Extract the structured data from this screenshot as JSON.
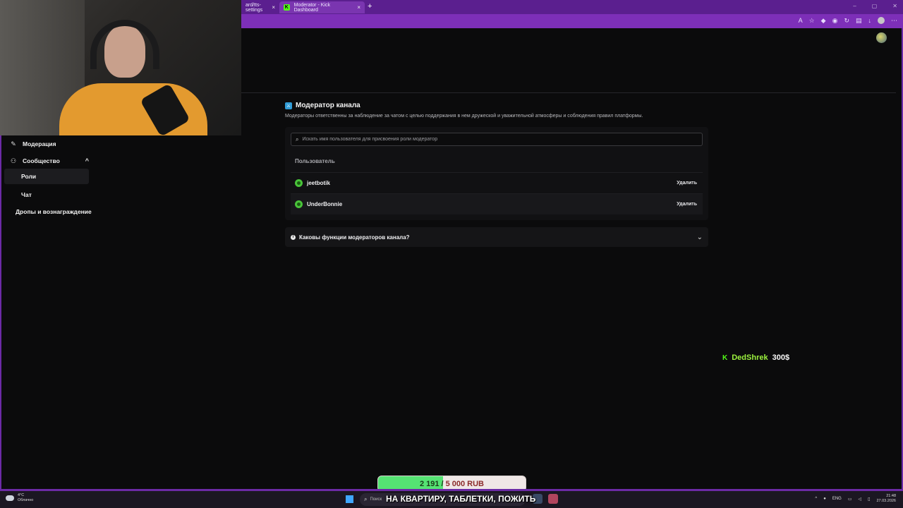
{
  "browser": {
    "tabs": [
      {
        "label": "ard/tts-settings",
        "active": false
      },
      {
        "label": "Moderator - Kick Dashboard",
        "active": true
      }
    ],
    "new_tab": "+",
    "close_glyph": "×",
    "window_controls": [
      "–",
      "▢",
      "✕"
    ],
    "kick_logo": "K"
  },
  "sidebar": {
    "items": [
      {
        "label": "Модерация",
        "icon": "wrench-icon"
      },
      {
        "label": "Сообщество",
        "icon": "community-icon",
        "expanded": true
      },
      {
        "label": "Роли",
        "selected": true
      },
      {
        "label": "Чат"
      },
      {
        "label": "Дропы и вознаграждение"
      }
    ]
  },
  "main": {
    "title": "Модератор канала",
    "description": "Модераторы ответственны за наблюдение за чатом с целью поддержания в нем дружеской и уважительной атмосферы и соблюдения правил платформы.",
    "search_placeholder": "Искать имя пользователя для присвоения роли модератор",
    "column_header": "Пользователь",
    "moderators": [
      {
        "username": "jeetbotik",
        "action": "Удалить"
      },
      {
        "username": "UnderBonnie",
        "action": "Удалить"
      }
    ],
    "faq_question": "Каковы функции модераторов канала?"
  },
  "overlay": {
    "donation": {
      "platform_logo": "K",
      "name": "DedShrek",
      "amount": "300$"
    },
    "goal": {
      "current": "2 191",
      "separator": "/",
      "target": "5 000 RUB",
      "progress": 0.438
    },
    "subtitle": "НА КВАРТИРУ, ТАБЛЕТКИ, ПОЖИТЬ"
  },
  "taskbar": {
    "weather_temp": "4°C",
    "weather_desc": "Облачно",
    "search_placeholder": "Поиск",
    "language": "ENG",
    "time": "21:48",
    "date": "27.03.2026"
  },
  "colors": {
    "accent_purple": "#7d2fb8",
    "kick_green": "#53fc18",
    "goal_fill": "#55e373"
  }
}
